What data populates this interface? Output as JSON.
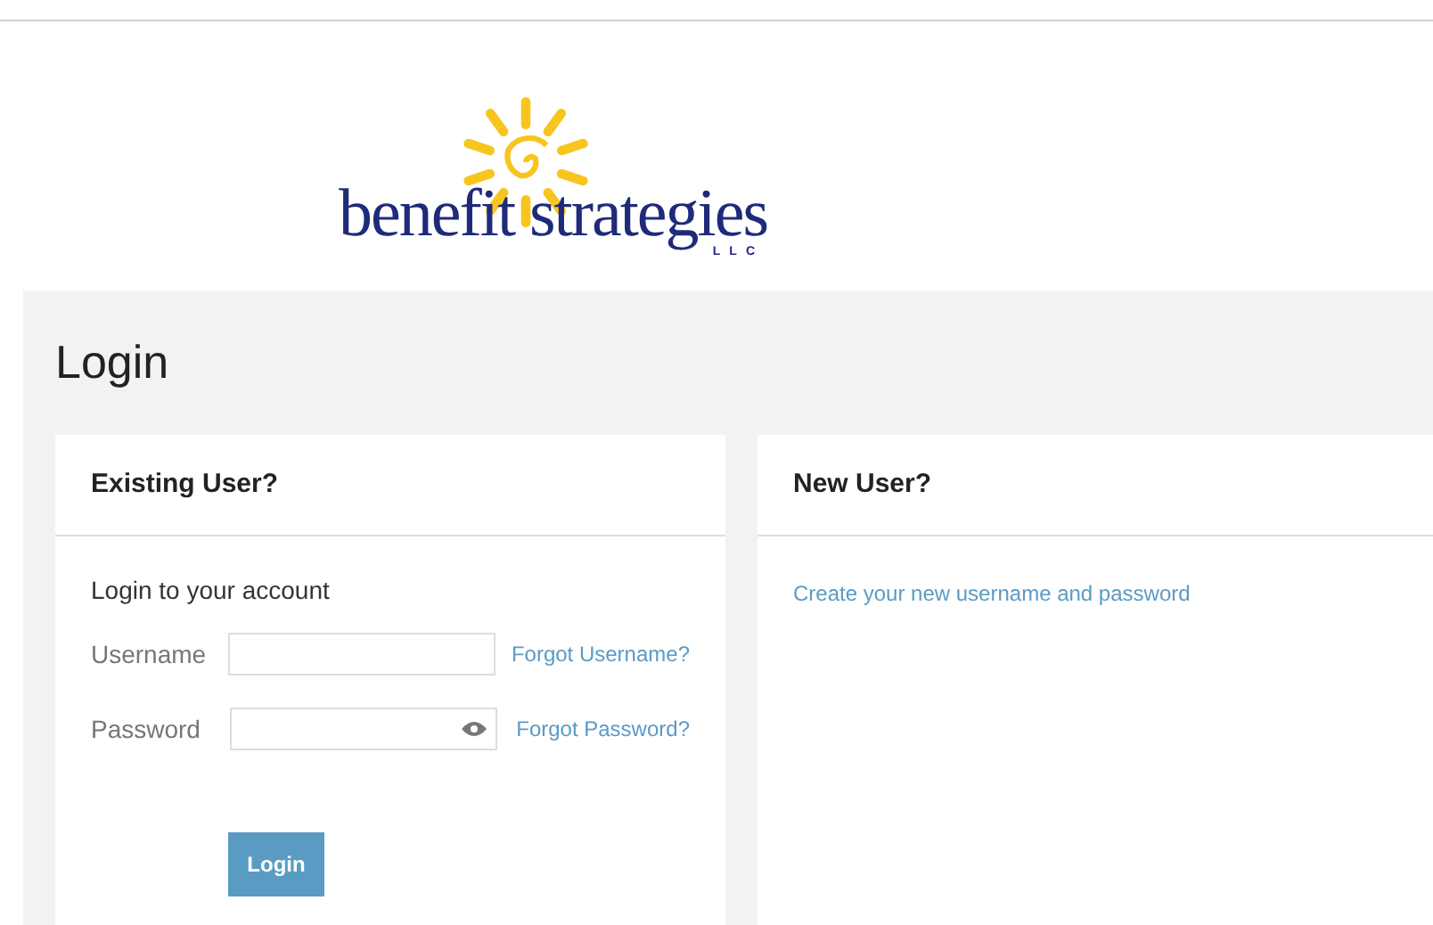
{
  "logo": {
    "name": "benefit strategies",
    "suffix": "LLC"
  },
  "page_title": "Login",
  "existing_user": {
    "title": "Existing User?",
    "subtitle": "Login to your account",
    "fields": [
      {
        "kind": "text",
        "label": "Username",
        "link": "Forgot Username?"
      },
      {
        "kind": "password",
        "label": "Password",
        "link": "Forgot Password?"
      }
    ],
    "button": "Login"
  },
  "new_user": {
    "title": "New User?",
    "link": "Create your new username and password"
  }
}
